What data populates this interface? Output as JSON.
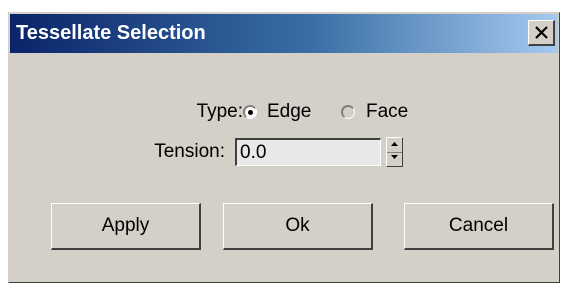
{
  "window": {
    "title": "Tessellate Selection",
    "close_icon": "close-icon"
  },
  "type": {
    "label": "Type:",
    "options": [
      {
        "label": "Edge",
        "selected": true
      },
      {
        "label": "Face",
        "selected": false
      }
    ]
  },
  "tension": {
    "label": "Tension:",
    "value": "0.0",
    "spinner_up_icon": "arrow-up-icon",
    "spinner_down_icon": "arrow-down-icon"
  },
  "buttons": {
    "apply": "Apply",
    "ok": "Ok",
    "cancel": "Cancel"
  },
  "colors": {
    "face": "#d4d0c8",
    "title_start": "#0a246a",
    "title_end": "#a6caf0",
    "title_text": "#ffffff"
  }
}
